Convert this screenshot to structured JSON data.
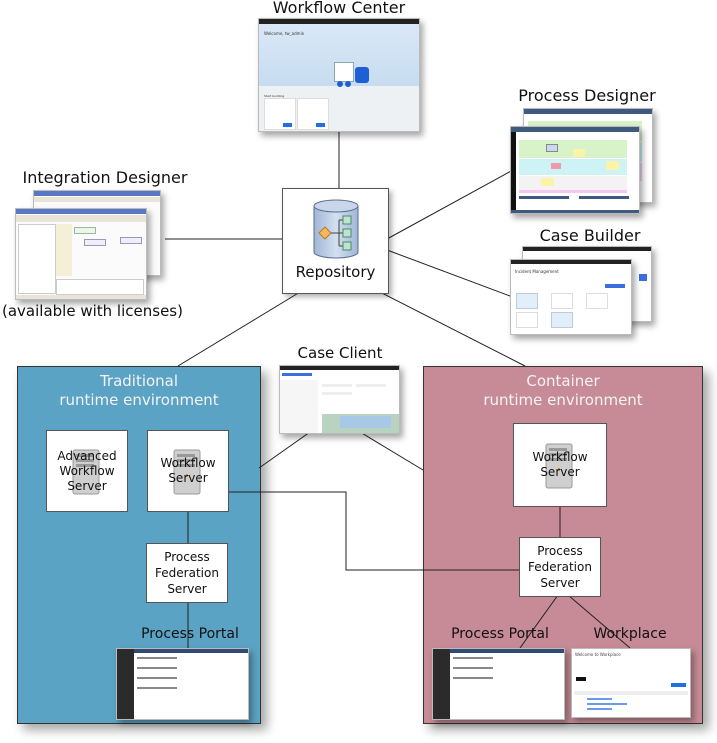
{
  "components": {
    "workflow_center": {
      "label": "Workflow Center",
      "screenshot": {
        "welcome": "Welcome, tw_admin",
        "section": "Start building"
      }
    },
    "process_designer": {
      "label": "Process Designer"
    },
    "case_builder": {
      "label": "Case Builder",
      "screenshot": {
        "title": "Incident Management"
      }
    },
    "integration_designer": {
      "label": "Integration Designer",
      "note": "(available with licenses)"
    },
    "repository": {
      "label": "Repository"
    },
    "case_client": {
      "label": "Case Client"
    }
  },
  "traditional_env": {
    "title_line1": "Traditional",
    "title_line2": "runtime environment",
    "color": "#5ba3c4",
    "nodes": {
      "advanced_workflow_server": [
        "Advanced",
        "Workflow",
        "Server"
      ],
      "workflow_server": [
        "Workflow",
        "Server"
      ],
      "process_federation_server": [
        "Process",
        "Federation",
        "Server"
      ]
    },
    "process_portal_label": "Process Portal"
  },
  "container_env": {
    "title_line1": "Container",
    "title_line2": "runtime environment",
    "color": "#c68b96",
    "nodes": {
      "workflow_server": [
        "Workflow",
        "Server"
      ],
      "process_federation_server": [
        "Process",
        "Federation",
        "Server"
      ]
    },
    "process_portal_label": "Process Portal",
    "workplace_label": "Workplace",
    "workplace_screenshot": {
      "title": "Welcome to Workplace"
    }
  }
}
